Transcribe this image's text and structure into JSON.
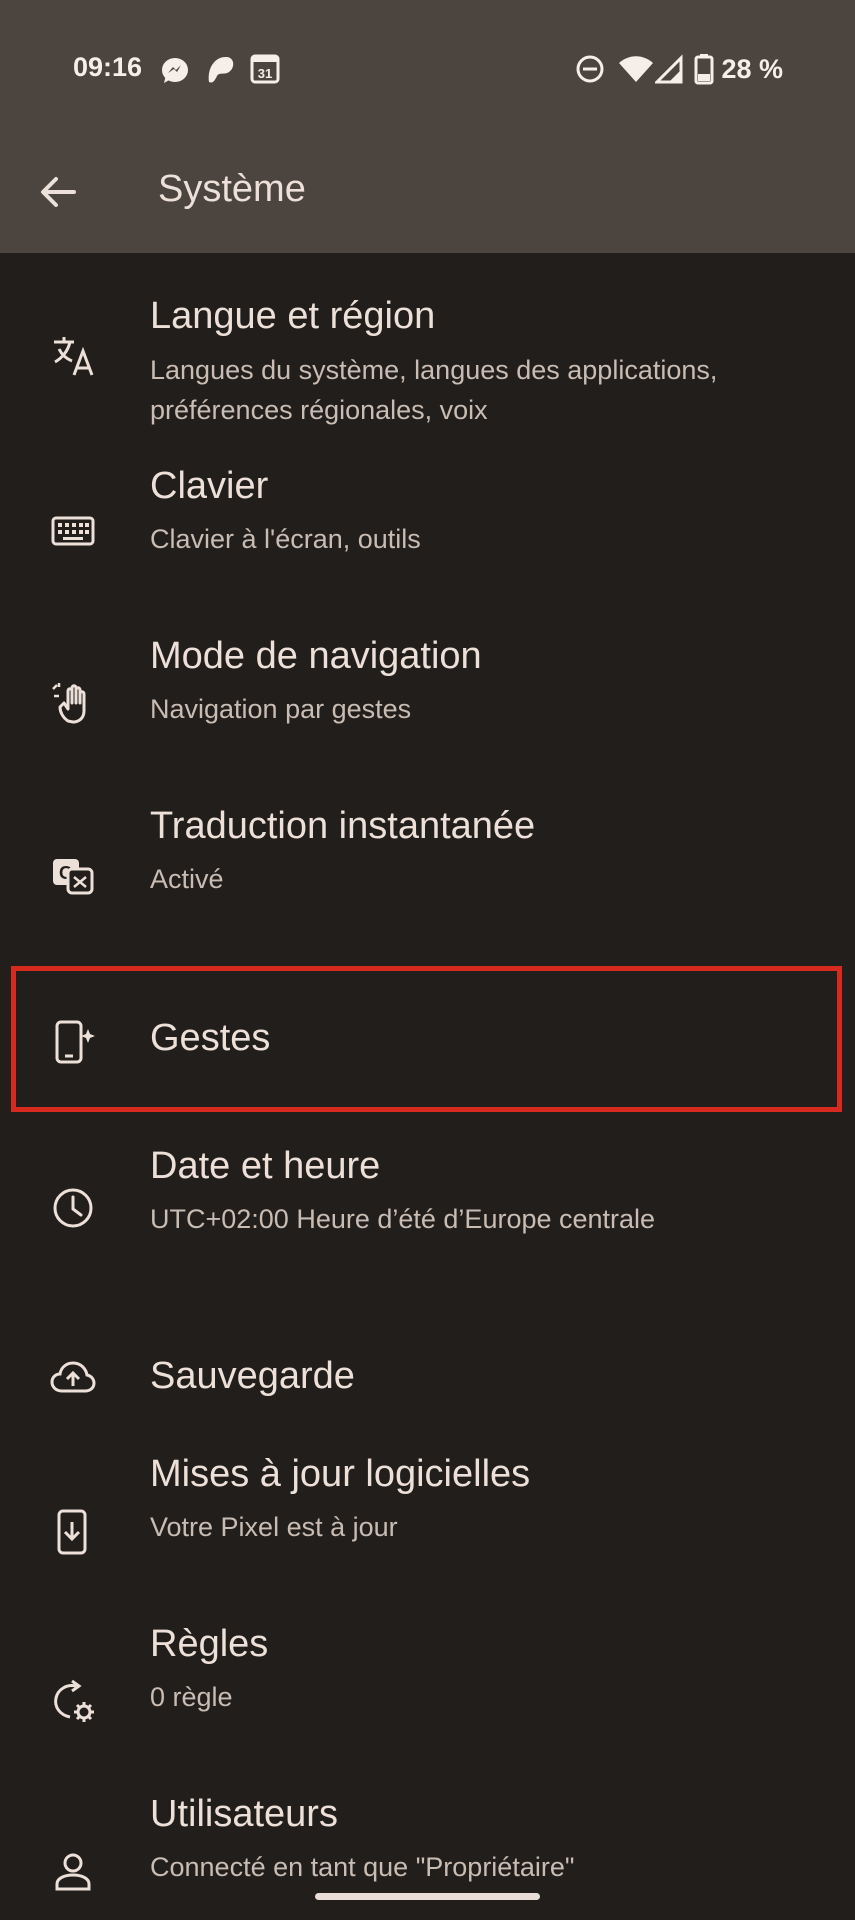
{
  "status": {
    "time": "09:16",
    "battery": "28 %",
    "calendar_day": "31"
  },
  "appbar": {
    "title": "Système"
  },
  "items": [
    {
      "icon": "translate-icon",
      "title": "Langue et région",
      "subtitle": "Langues du système, langues des applications, préférences régionales, voix"
    },
    {
      "icon": "keyboard-icon",
      "title": "Clavier",
      "subtitle": "Clavier à l'écran, outils"
    },
    {
      "icon": "gesture-hand-icon",
      "title": "Mode de navigation",
      "subtitle": "Navigation par gestes"
    },
    {
      "icon": "live-translate-icon",
      "title": "Traduction instantanée",
      "subtitle": "Activé"
    },
    {
      "icon": "phone-sparkle-icon",
      "title": "Gestes",
      "subtitle": ""
    },
    {
      "icon": "clock-icon",
      "title": "Date et heure",
      "subtitle": "UTC+02:00 Heure d’été d’Europe centrale"
    },
    {
      "icon": "cloud-upload-icon",
      "title": "Sauvegarde",
      "subtitle": ""
    },
    {
      "icon": "system-update-icon",
      "title": "Mises à jour logicielles",
      "subtitle": "Votre Pixel est à jour"
    },
    {
      "icon": "rules-icon",
      "title": "Règles",
      "subtitle": "0 règle"
    },
    {
      "icon": "person-icon",
      "title": "Utilisateurs",
      "subtitle": "Connecté en tant que \"Propriétaire\""
    }
  ],
  "colors": {
    "highlight": "#d62a1f",
    "header_bg": "#4c443e",
    "body_bg": "#221e1b"
  }
}
